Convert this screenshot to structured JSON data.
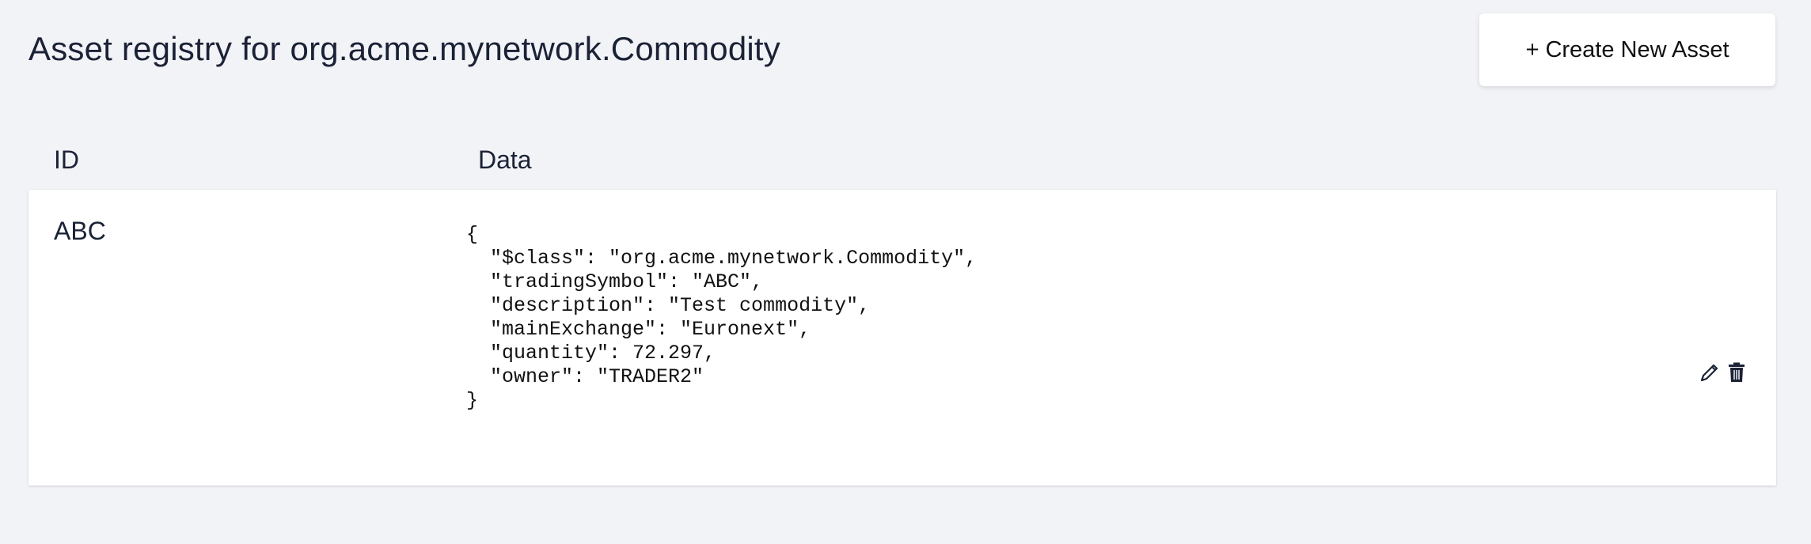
{
  "page": {
    "title": "Asset registry for org.acme.mynetwork.Commodity"
  },
  "toolbar": {
    "create_label": "+ Create New Asset"
  },
  "table": {
    "columns": [
      "ID",
      "Data"
    ],
    "rows": [
      {
        "id": "ABC",
        "data": "{\n  \"$class\": \"org.acme.mynetwork.Commodity\",\n  \"tradingSymbol\": \"ABC\",\n  \"description\": \"Test commodity\",\n  \"mainExchange\": \"Euronext\",\n  \"quantity\": 72.297,\n  \"owner\": \"TRADER2\"\n}",
        "actions": [
          "pencil-icon",
          "trash-icon"
        ]
      }
    ]
  }
}
